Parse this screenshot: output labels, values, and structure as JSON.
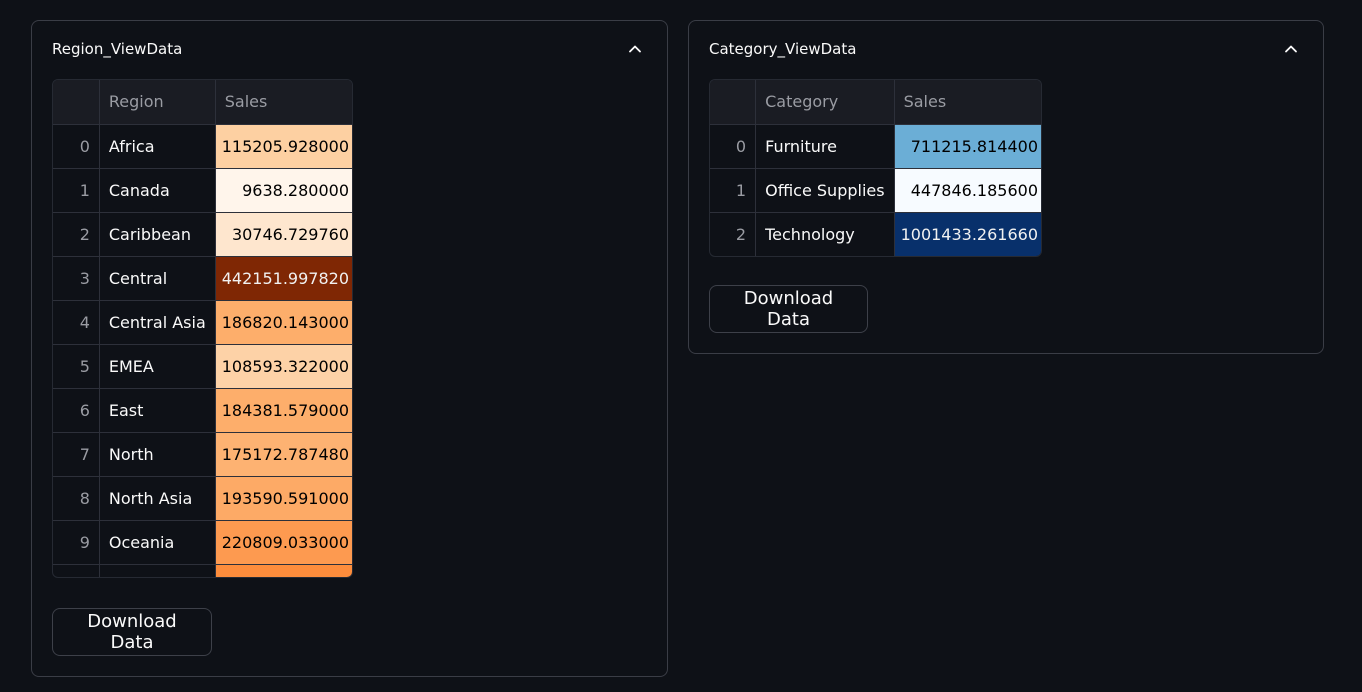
{
  "region_panel": {
    "title": "Region_ViewData",
    "columns": [
      "",
      "Region",
      "Sales"
    ],
    "rows": [
      {
        "index": "0",
        "name": "Africa",
        "sales": "115205.928000",
        "bg": "#fdd0a2",
        "fg": "#000000"
      },
      {
        "index": "1",
        "name": "Canada",
        "sales": "9638.280000",
        "bg": "#fff5eb",
        "fg": "#000000"
      },
      {
        "index": "2",
        "name": "Caribbean",
        "sales": "30746.729760",
        "bg": "#fee6ce",
        "fg": "#000000"
      },
      {
        "index": "3",
        "name": "Central",
        "sales": "442151.997820",
        "bg": "#7f2704",
        "fg": "#f1f1f1"
      },
      {
        "index": "4",
        "name": "Central Asia",
        "sales": "186820.143000",
        "bg": "#fdae6b",
        "fg": "#000000"
      },
      {
        "index": "5",
        "name": "EMEA",
        "sales": "108593.322000",
        "bg": "#fdd2a7",
        "fg": "#000000"
      },
      {
        "index": "6",
        "name": "East",
        "sales": "184381.579000",
        "bg": "#fdae6b",
        "fg": "#000000"
      },
      {
        "index": "7",
        "name": "North",
        "sales": "175172.787480",
        "bg": "#fdb272",
        "fg": "#000000"
      },
      {
        "index": "8",
        "name": "North Asia",
        "sales": "193590.591000",
        "bg": "#fdaa66",
        "fg": "#000000"
      },
      {
        "index": "9",
        "name": "Oceania",
        "sales": "220809.033000",
        "bg": "#fd9a50",
        "fg": "#000000"
      }
    ],
    "partial_row_bg": "#fd8d3c",
    "download_label": "Download Data"
  },
  "category_panel": {
    "title": "Category_ViewData",
    "columns": [
      "",
      "Category",
      "Sales"
    ],
    "rows": [
      {
        "index": "0",
        "name": "Furniture",
        "sales": "711215.814400",
        "bg": "#6baed6",
        "fg": "#000000"
      },
      {
        "index": "1",
        "name": "Office Supplies",
        "sales": "447846.185600",
        "bg": "#f7fbff",
        "fg": "#000000"
      },
      {
        "index": "2",
        "name": "Technology",
        "sales": "1001433.261660",
        "bg": "#08306b",
        "fg": "#f1f1f1"
      }
    ],
    "download_label": "Download Data"
  },
  "icons": {
    "collapse": "chevron-up-icon"
  }
}
